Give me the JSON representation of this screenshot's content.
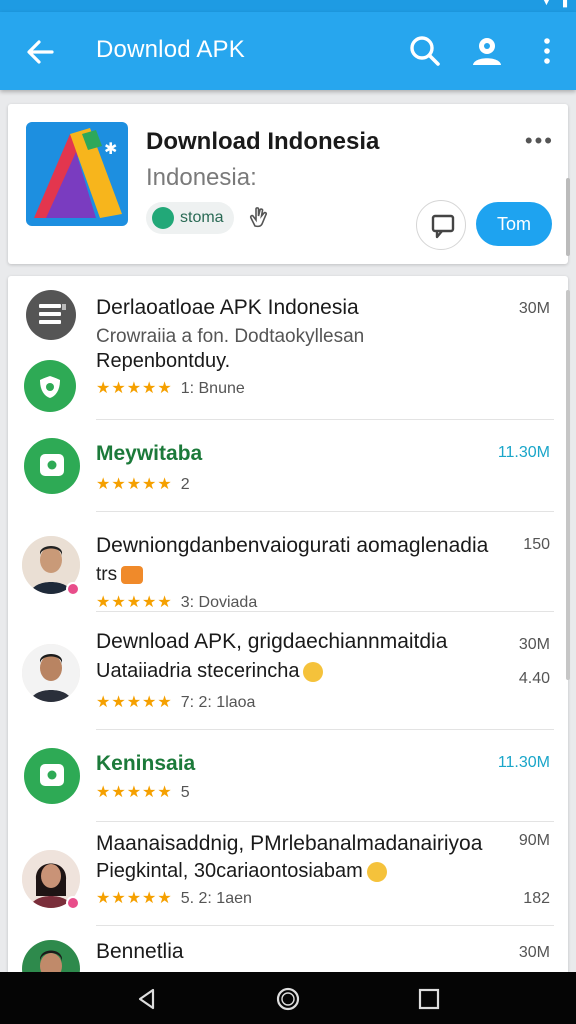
{
  "appbar": {
    "title": "Downlod APK"
  },
  "app": {
    "title": "Download Indonesia",
    "subtitle": "Indonesia:",
    "chip_label": "stoma",
    "open_label": "Tom"
  },
  "list": [
    {
      "line1": "Derlaoatloae APK Indonesia",
      "line2": "Crowraiia a fon. Dodtaokyllesan",
      "line3": "Repenbontduy.",
      "rating_text": "1: Bnune",
      "size": "30M"
    },
    {
      "line1": "Meywitaba",
      "rating_text": "2",
      "size": "11.30M"
    },
    {
      "line1": "Dewniongdanbenvaiogurati aomaglenadia",
      "line2": "trs",
      "rating_text": "3: Doviada",
      "size": "150"
    },
    {
      "line1": "Dewnload APK, grigdaechiannmaitdia",
      "line2": "Uataiiadria stecerincha",
      "rating_text": "7: 2: 1laoa",
      "size": "30M",
      "size2": "4.40"
    },
    {
      "line1": "Keninsaia",
      "rating_text": "5",
      "size": "11.30M"
    },
    {
      "line1": "Maanaisaddnig, PMrlebanalmadanairiyoa",
      "line2": "Piegkintal, 30cariaontosiabam",
      "rating_text": "5. 2: 1aen",
      "size": "90M",
      "size2": "182"
    },
    {
      "line1": "Bennetlia",
      "size": "30M"
    }
  ],
  "icons": [
    "back-arrow-icon",
    "search-icon",
    "account-icon",
    "overflow-menu-icon",
    "more-horizontal-icon",
    "hand-icon",
    "message-icon",
    "nav-back-icon",
    "nav-home-icon",
    "nav-recents-icon"
  ],
  "colors": {
    "appbar": "#27a6ee",
    "accent": "#1ea3f0",
    "star": "#f5a000",
    "green": "#2eaa55"
  }
}
